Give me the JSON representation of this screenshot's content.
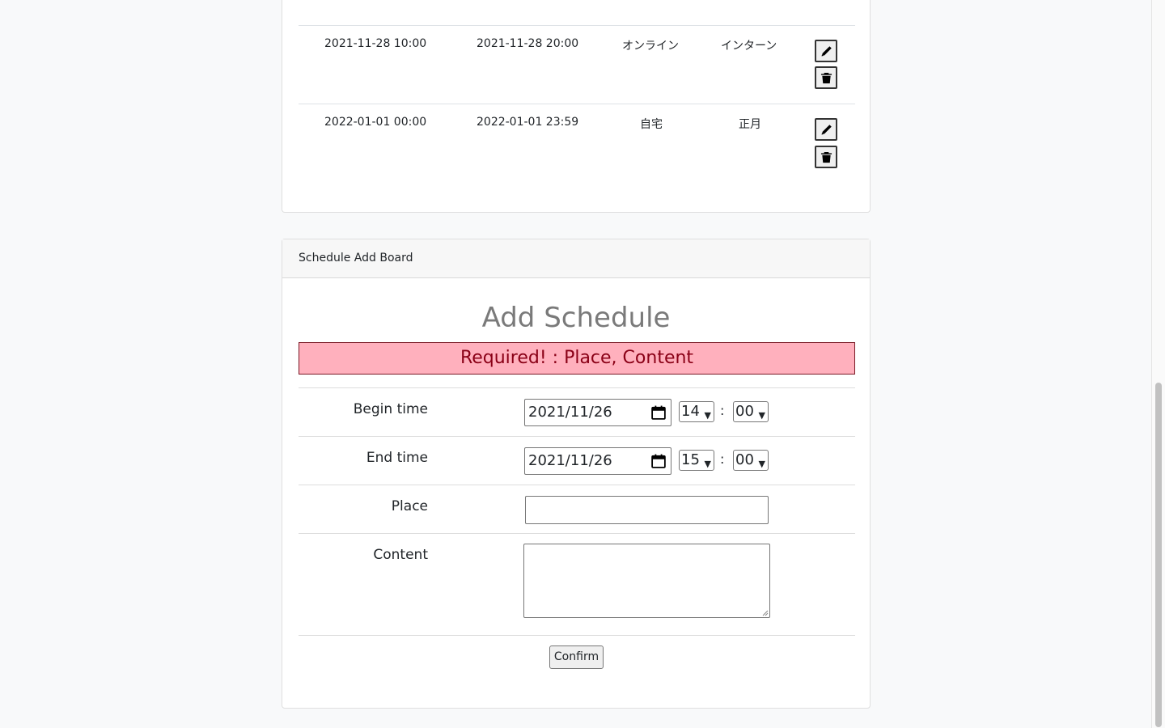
{
  "schedule_list": {
    "rows": [
      {
        "begin": "2021-11-28 10:00",
        "end": "2021-11-28 20:00",
        "place": "オンライン",
        "content": "インターン"
      },
      {
        "begin": "2022-01-01 00:00",
        "end": "2022-01-01 23:59",
        "place": "自宅",
        "content": "正月"
      }
    ]
  },
  "add_board": {
    "header": "Schedule Add Board",
    "title": "Add Schedule",
    "alert": "Required! : Place, Content",
    "begin": {
      "label": "Begin time",
      "date": "2021/11/26",
      "hour": "14",
      "minute": "00"
    },
    "end": {
      "label": "End time",
      "date": "2021/11/26",
      "hour": "15",
      "minute": "00"
    },
    "place": {
      "label": "Place",
      "value": ""
    },
    "content": {
      "label": "Content",
      "value": ""
    },
    "colon": ":",
    "confirm_label": "Confirm"
  },
  "icons": {
    "edit": "pencil-icon",
    "delete": "trash-icon",
    "calendar": "calendar-icon"
  },
  "colors": {
    "alert_bg": "#ffb0bd",
    "alert_text": "#8a0016",
    "page_bg": "#f8f9fa"
  }
}
